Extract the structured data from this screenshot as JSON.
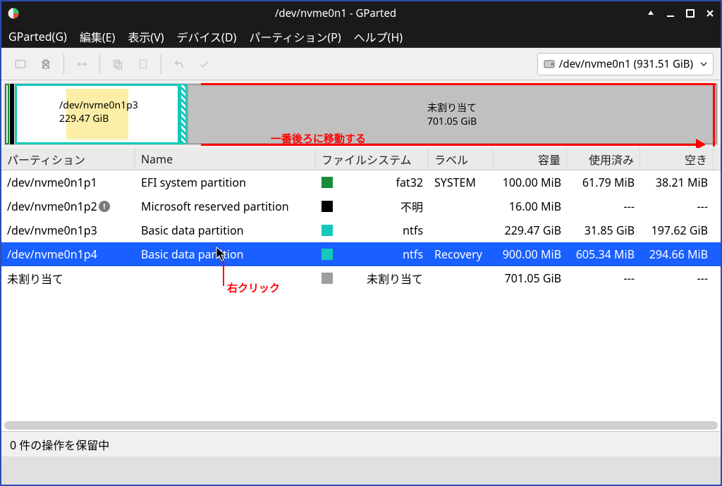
{
  "window": {
    "title": "/dev/nvme0n1 - GParted"
  },
  "menu": {
    "gparted": "GParted(G)",
    "edit": "編集(E)",
    "view": "表示(V)",
    "device": "デバイス(D)",
    "partition": "パーティション(P)",
    "help": "ヘルプ(H)"
  },
  "toolbar": {
    "device_selector": "/dev/nvme0n1  (931.51 GiB)"
  },
  "diskmap": {
    "p3": {
      "name": "/dev/nvme0n1p3",
      "size": "229.47 GiB"
    },
    "unalloc": {
      "name": "未割り当て",
      "size": "701.05 GiB"
    }
  },
  "annotations": {
    "move_text": "一番後ろに移動する",
    "right_click": "右クリック"
  },
  "columns": {
    "partition": "パーティション",
    "name": "Name",
    "filesystem": "ファイルシステム",
    "label": "ラベル",
    "size": "容量",
    "used": "使用済み",
    "free": "空き"
  },
  "rows": [
    {
      "part": "/dev/nvme0n1p1",
      "info": false,
      "name": "EFI system partition",
      "fs": "fat32",
      "sw": "sw-fat32",
      "label": "SYSTEM",
      "size": "100.00 MiB",
      "used": "61.79 MiB",
      "free": "38.21 MiB"
    },
    {
      "part": "/dev/nvme0n1p2",
      "info": true,
      "name": "Microsoft reserved partition",
      "fs": "不明",
      "sw": "sw-unknown",
      "label": "",
      "size": "16.00 MiB",
      "used": "---",
      "free": "---"
    },
    {
      "part": "/dev/nvme0n1p3",
      "info": false,
      "name": "Basic data partition",
      "fs": "ntfs",
      "sw": "sw-ntfs",
      "label": "",
      "size": "229.47 GiB",
      "used": "31.85 GiB",
      "free": "197.62 GiB"
    },
    {
      "part": "/dev/nvme0n1p4",
      "info": false,
      "name": "Basic data partition",
      "fs": "ntfs",
      "sw": "sw-ntfs",
      "label": "Recovery",
      "size": "900.00 MiB",
      "used": "605.34 MiB",
      "free": "294.66 MiB"
    },
    {
      "part": "未割り当て",
      "info": false,
      "name": "",
      "fs": "未割り当て",
      "sw": "sw-unalloc",
      "label": "",
      "size": "701.05 GiB",
      "used": "---",
      "free": "---"
    }
  ],
  "status": "0 件の操作を保留中"
}
